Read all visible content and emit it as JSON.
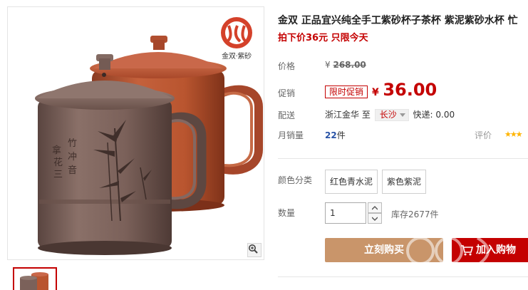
{
  "brand": {
    "logo_text": "金双·紫砂",
    "accent": "#c40000"
  },
  "product": {
    "title": "金双 正品宜兴纯全手工紫砂杯子茶杯 紫泥紫砂水杯 忙",
    "promo_line": "拍下价36元 只限今天"
  },
  "pricing": {
    "price_label": "价格",
    "original_currency": "¥",
    "original_price": "268.00",
    "promo_label": "促销",
    "promo_tag": "限时促销",
    "current_currency": "¥",
    "current_price": "36.00"
  },
  "shipping": {
    "label": "配送",
    "from": "浙江金华",
    "to_word": "至",
    "to_city": "长沙",
    "method_text": "快递: 0.00"
  },
  "sales": {
    "label": "月销量",
    "count": "22",
    "unit": "件",
    "rating_label": "评价",
    "stars": "★★★"
  },
  "options": {
    "color_label": "颜色分类",
    "choices": [
      "红色青水泥",
      "紫色紫泥"
    ]
  },
  "quantity": {
    "label": "数量",
    "value": "1",
    "stock_text": "库存2677件"
  },
  "actions": {
    "buy_now": "立刻购买",
    "add_to_cart": "加入购物"
  },
  "colors": {
    "buy_now_bg": "#c9956a",
    "cart_bg": "#c40000",
    "price_red": "#c40000",
    "sales_blue": "#2953a6"
  },
  "icons": [
    "zoom-icon",
    "chevron-down-icon",
    "cart-icon",
    "brand-logo"
  ]
}
